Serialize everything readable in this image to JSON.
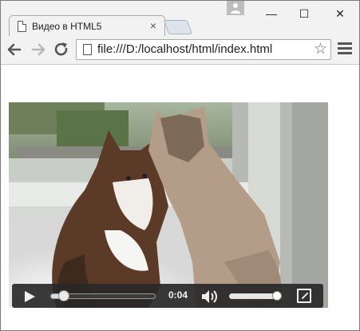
{
  "tab": {
    "title": "Видео в HTML5",
    "close": "×"
  },
  "window_controls": {
    "minimize": "—",
    "maximize": "☐",
    "close": "✕"
  },
  "address_bar": {
    "url": "file:///D:/localhost/html/index.html",
    "bookmark": "☆"
  },
  "video": {
    "current_time": "0:04",
    "progress_fraction": 0.12,
    "volume_fraction": 1.0
  },
  "icons": {
    "back": "back-arrow-icon",
    "forward": "forward-arrow-icon",
    "reload": "reload-icon",
    "menu": "hamburger-menu-icon",
    "play": "play-icon",
    "volume": "volume-icon",
    "fullscreen": "fullscreen-icon"
  }
}
